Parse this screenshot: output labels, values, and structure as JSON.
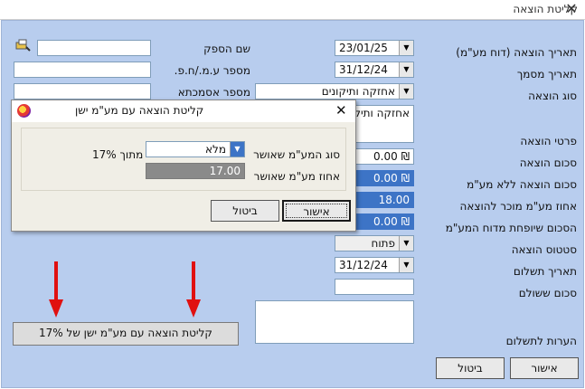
{
  "window": {
    "title": "קליטת הוצאה",
    "close_icon": "close-icon"
  },
  "form": {
    "labels": {
      "supplier_name": "שם הספק",
      "dealer_number": "מספר ע.מ./ח.פ.",
      "reference_number": "מספר אסמכתא",
      "expense_date": "תאריך הוצאה (דוח מע\"מ)",
      "document_date": "תאריך מסמך",
      "expense_type": "סוג הוצאה",
      "expense_details": "פרטי הוצאה",
      "expense_amount": "סכום הוצאה",
      "amount_without_vat": "סכום הוצאה ללא מע\"מ",
      "vat_percent": "אחוז מע\"מ מוכר להוצאה",
      "vat_amount": "הסכום שיופחת מדוח המע\"מ",
      "status": "סטטוס הוצאה",
      "payment_date": "תאריך תשלום",
      "paid_amount": "סכום ששולם",
      "payment_notes": "הערות לתשלום"
    },
    "values": {
      "expense_date": "23/01/25",
      "document_date": "31/12/24",
      "expense_type": "אחזקה ותיקונים",
      "expense_details": "אחזקה ותיקונים",
      "expense_amount": "0.00 ₪",
      "amount_without_vat": "0.00 ₪",
      "vat_percent": "18.00",
      "vat_amount": "0.00 ₪",
      "status": "פתוח",
      "payment_date": "31/12/24"
    },
    "old_vat_button": "קליטת הוצאה עם מע\"מ ישן של 17%",
    "ok_button": "אישור",
    "cancel_button": "ביטול"
  },
  "dialog": {
    "title": "קליטת הוצאה עם מע\"מ ישן",
    "vat_type_label": "סוג המע\"מ שאושר",
    "vat_type_value": "מלא",
    "of_label": "מתוך 17%",
    "vat_percent_label": "אחוז מע\"מ שאושר",
    "vat_percent_value": "17.00",
    "ok_button": "אישור",
    "cancel_button": "ביטול"
  },
  "colors": {
    "client_bg": "#b8cdee",
    "highlight_field": "#3d74c6",
    "arrow": "#e01010"
  }
}
